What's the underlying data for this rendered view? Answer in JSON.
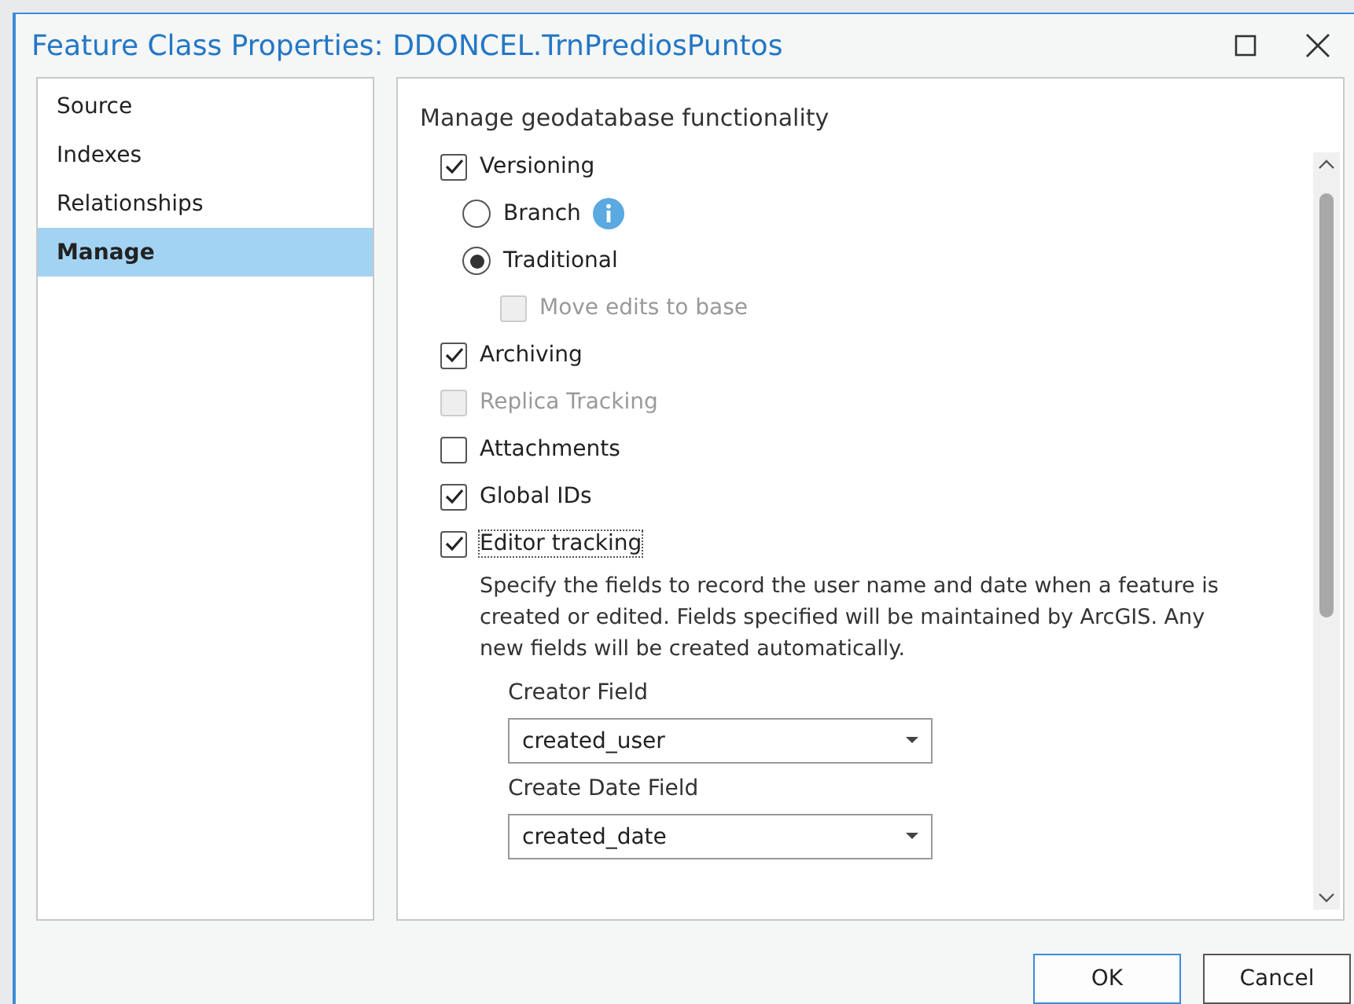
{
  "window": {
    "title": "Feature Class Properties: DDONCEL.TrnPrediosPuntos"
  },
  "sidebar": {
    "items": [
      {
        "label": "Source",
        "selected": false
      },
      {
        "label": "Indexes",
        "selected": false
      },
      {
        "label": "Relationships",
        "selected": false
      },
      {
        "label": "Manage",
        "selected": true
      }
    ]
  },
  "panel": {
    "heading": "Manage geodatabase functionality",
    "options": [
      {
        "kind": "checkbox",
        "label": "Versioning",
        "checked": true,
        "disabled": false,
        "focused": false,
        "children": [
          {
            "kind": "radio",
            "label": "Branch",
            "selected": false,
            "info": true
          },
          {
            "kind": "radio",
            "label": "Traditional",
            "selected": true,
            "children": [
              {
                "kind": "checkbox",
                "label": "Move edits to base",
                "checked": false,
                "disabled": true,
                "focused": false
              }
            ]
          }
        ]
      },
      {
        "kind": "checkbox",
        "label": "Archiving",
        "checked": true,
        "disabled": false,
        "focused": false
      },
      {
        "kind": "checkbox",
        "label": "Replica Tracking",
        "checked": false,
        "disabled": true,
        "focused": false
      },
      {
        "kind": "checkbox",
        "label": "Attachments",
        "checked": false,
        "disabled": false,
        "focused": false
      },
      {
        "kind": "checkbox",
        "label": "Global IDs",
        "checked": true,
        "disabled": false,
        "focused": false
      },
      {
        "kind": "checkbox",
        "label": "Editor tracking",
        "checked": true,
        "disabled": false,
        "focused": true,
        "description": "Specify the fields to record the user name and date when a feature is created or edited. Fields specified will be maintained by ArcGIS. Any new fields will be created automatically.",
        "fields": [
          {
            "label": "Creator Field",
            "value": "created_user"
          },
          {
            "label": "Create Date Field",
            "value": "created_date"
          }
        ]
      }
    ]
  },
  "buttons": [
    {
      "label": "OK",
      "default": true
    },
    {
      "label": "Cancel",
      "default": false
    }
  ]
}
